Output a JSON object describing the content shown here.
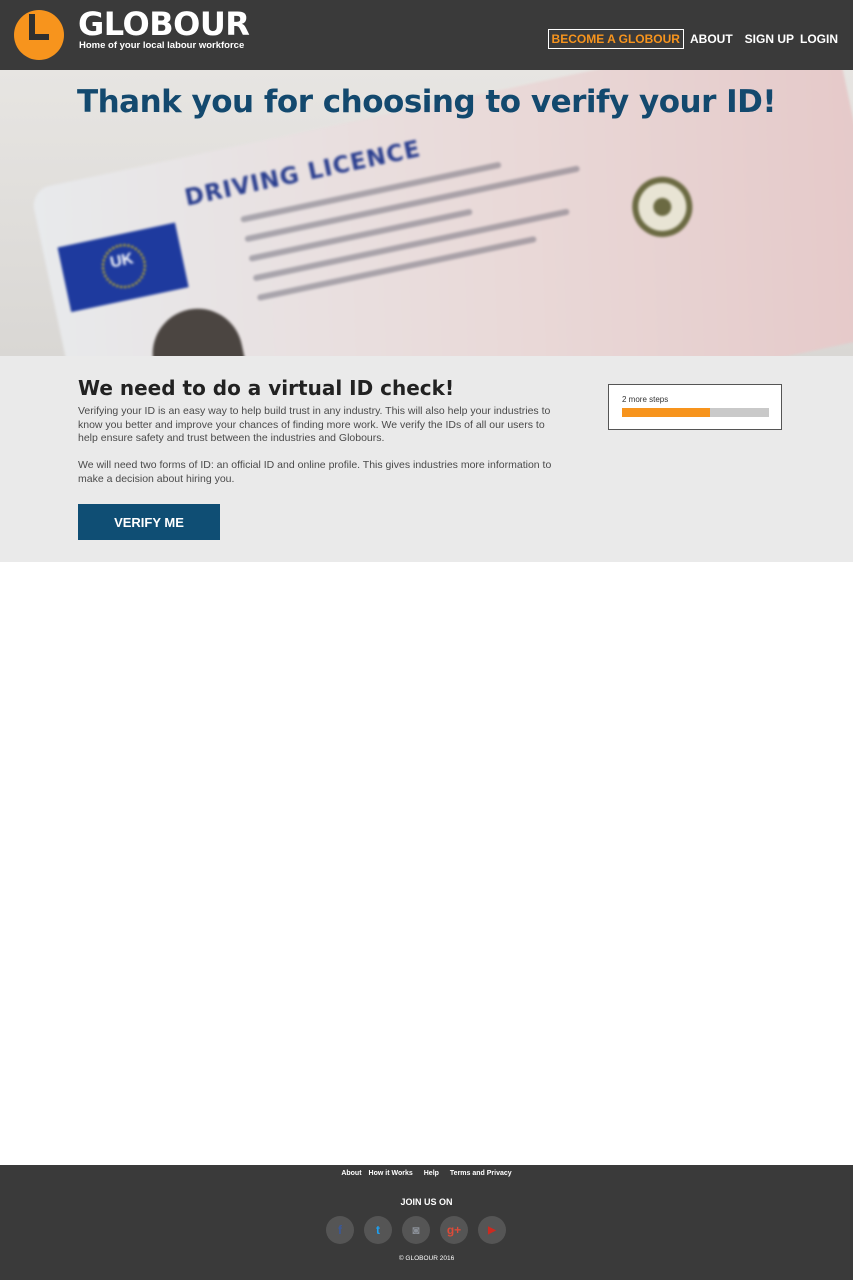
{
  "header": {
    "brand": "GLOBOUR",
    "tagline": "Home of your local labour workforce",
    "nav": {
      "become": "BECOME A GLOBOUR",
      "about": "ABOUT",
      "signup": "SIGN UP",
      "login": "LOGIN"
    }
  },
  "hero": {
    "title": "Thank you for choosing to verify your ID!",
    "card_title": "DRIVING LICENCE",
    "card_country": "UK"
  },
  "info": {
    "heading": "We need to do a virtual ID check!",
    "paragraph1": "Verifying your ID is an easy way to help build trust in any industry. This will also help your industries to know you better and improve your chances of finding more work. We verify the IDs of all our users to help ensure safety and trust between the industries and Globours.",
    "paragraph2": "We will need two forms of ID: an official ID and online profile. This gives industries more information to make a decision about hiring you.",
    "verify_button": "VERIFY ME"
  },
  "progress": {
    "label": "2 more steps",
    "fraction": 0.6,
    "fill_color": "#f7941d"
  },
  "footer": {
    "links": [
      "About",
      "How it Works",
      "Help",
      "Terms and Privacy"
    ],
    "join_label": "JOIN US ON",
    "socials": [
      {
        "name": "facebook-icon",
        "glyph": "f"
      },
      {
        "name": "twitter-icon",
        "glyph": "t"
      },
      {
        "name": "instagram-icon",
        "glyph": "◙"
      },
      {
        "name": "google-plus-icon",
        "glyph": "g+"
      },
      {
        "name": "youtube-icon",
        "glyph": "▶"
      }
    ],
    "copyright": "© GLOBOUR 2016"
  },
  "colors": {
    "accent": "#f7941d",
    "primary": "#0f4e74",
    "header_bg": "#3a3a3a"
  }
}
